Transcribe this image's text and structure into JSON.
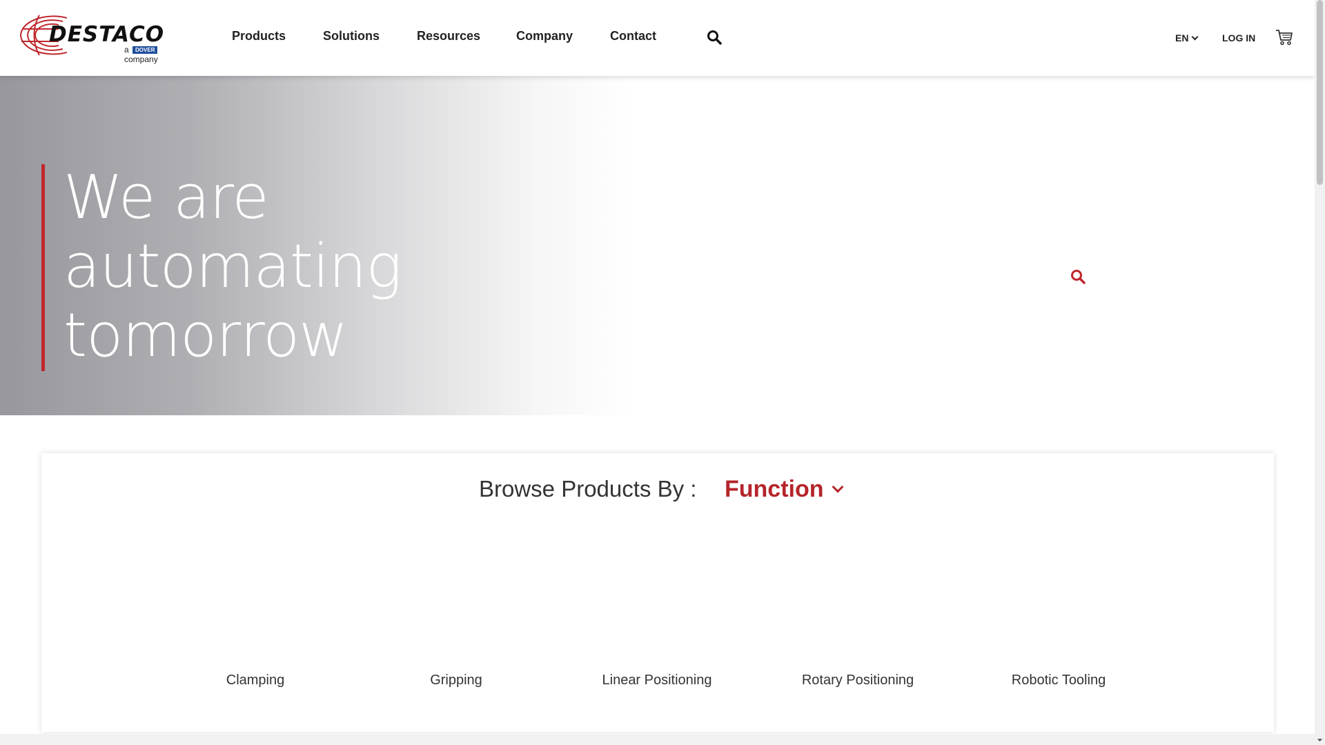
{
  "brand": {
    "name": "DESTACO",
    "tagline_a": "a",
    "tagline_dover": "DOVER",
    "tagline_company": "company",
    "accent_color": "#c0272d"
  },
  "nav": {
    "items": [
      "Products",
      "Solutions",
      "Resources",
      "Company",
      "Contact"
    ],
    "search_icon": "search-icon"
  },
  "utility": {
    "language": "EN",
    "login": "LOG IN",
    "cart_icon": "cart-icon"
  },
  "hero": {
    "title_lines": [
      "We are",
      "automating",
      "tomorrow"
    ],
    "search_icon": "search-icon"
  },
  "browse": {
    "label": "Browse Products By :",
    "selected": "Function",
    "categories": [
      "Clamping",
      "Gripping",
      "Linear Positioning",
      "Rotary Positioning",
      "Robotic Tooling"
    ]
  }
}
